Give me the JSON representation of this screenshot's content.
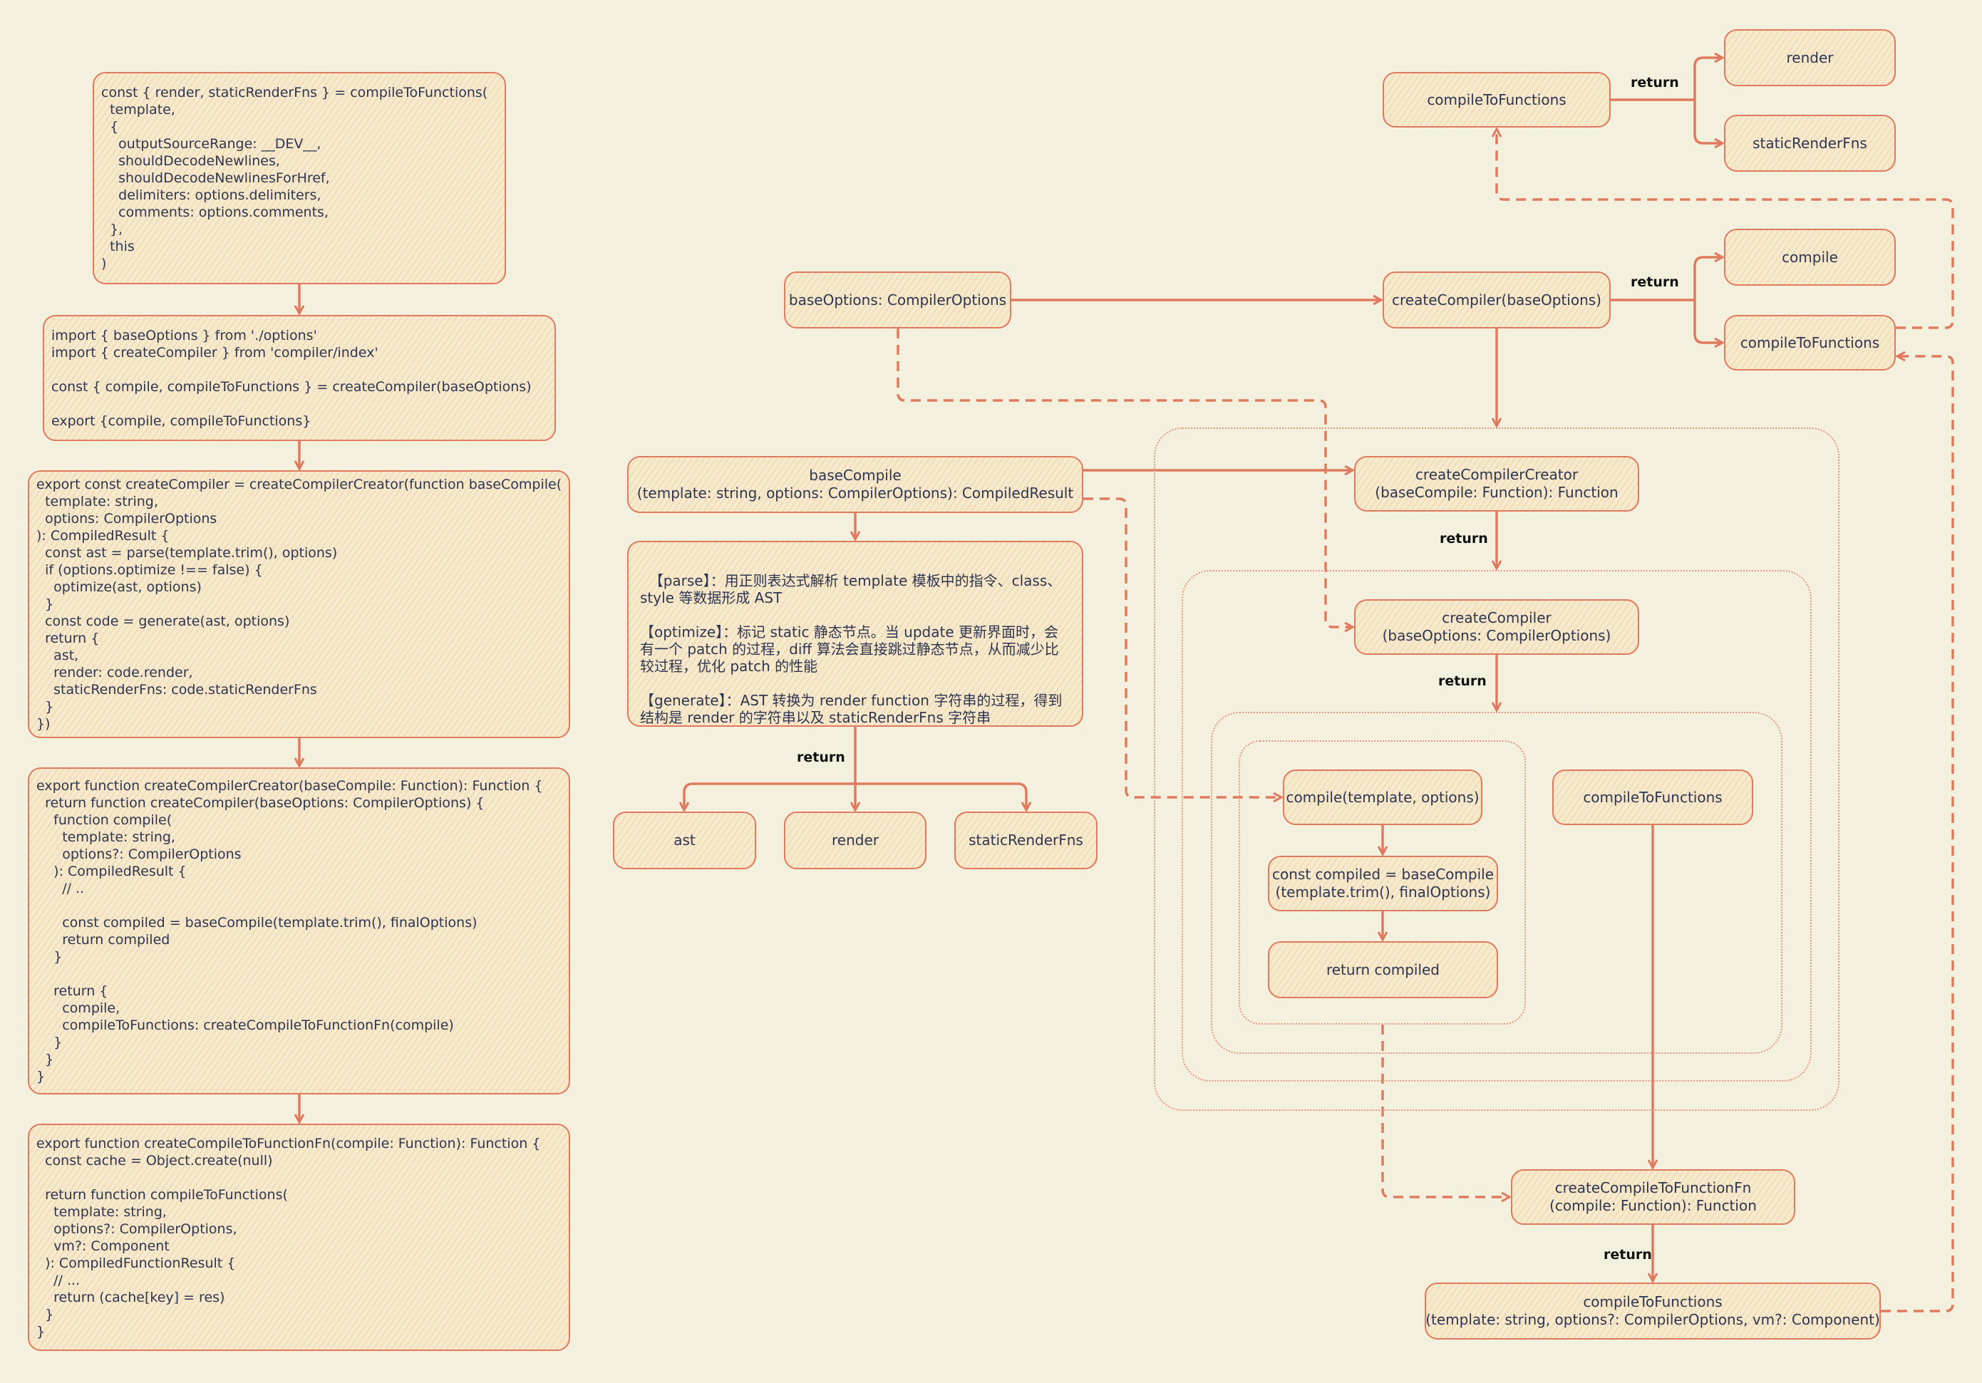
{
  "code_blocks": [
    {
      "lines": "const { render, staticRenderFns } = compileToFunctions(\n  template,\n  {\n    outputSourceRange: __DEV__,\n    shouldDecodeNewlines,\n    shouldDecodeNewlinesForHref,\n    delimiters: options.delimiters,\n    comments: options.comments,\n  },\n  this\n)"
    },
    {
      "lines": "import { baseOptions } from './options'\nimport { createCompiler } from 'compiler/index'\n\nconst { compile, compileToFunctions } = createCompiler(baseOptions)\n\nexport {compile, compileToFunctions}"
    },
    {
      "lines": "export const createCompiler = createCompilerCreator(function baseCompile(\n  template: string,\n  options: CompilerOptions\n): CompiledResult {\n  const ast = parse(template.trim(), options)\n  if (options.optimize !== false) {\n    optimize(ast, options)\n  }\n  const code = generate(ast, options)\n  return {\n    ast,\n    render: code.render,\n    staticRenderFns: code.staticRenderFns\n  }\n})"
    },
    {
      "lines": "export function createCompilerCreator(baseCompile: Function): Function {\n  return function createCompiler(baseOptions: CompilerOptions) {\n    function compile(\n      template: string,\n      options?: CompilerOptions\n    ): CompiledResult {\n      // ..\n\n      const compiled = baseCompile(template.trim(), finalOptions)\n      return compiled\n    }\n\n    return {\n      compile,\n      compileToFunctions: createCompileToFunctionFn(compile)\n    }\n  }\n}"
    },
    {
      "lines": "export function createCompileToFunctionFn(compile: Function): Function {\n  const cache = Object.create(null)\n\n  return function compileToFunctions(\n    template: string,\n    options?: CompilerOptions,\n    vm?: Component\n  ): CompiledFunctionResult {\n    // ...\n    return (cache[key] = res)\n  }\n}"
    }
  ],
  "middle": {
    "base_compile": "baseCompile\n(template: string, options: CompilerOptions): CompiledResult",
    "description": "【parse】：用正则表达式解析 template 模板中的指令、class、style 等数据形成 AST\n\n【optimize】：标记 static 静态节点。当 update 更新界面时，会有一个 patch 的过程，diff 算法会直接跳过静态节点，从而减少比较过程，优化 patch 的性能\n\n【generate】：AST 转换为 render function 字符串的过程，得到结构是 render 的字符串以及 staticRenderFns 字符串",
    "return_label": "return",
    "outputs": [
      "ast",
      "render",
      "staticRenderFns"
    ],
    "base_options": "baseOptions: CompilerOptions"
  },
  "right": {
    "compile_to_functions_top": "compileToFunctions",
    "top_outputs": [
      "render",
      "staticRenderFns"
    ],
    "create_compiler_call": "createCompiler(baseOptions)",
    "compiler_outputs": [
      "compile",
      "compileToFunctions"
    ],
    "create_compiler_creator": "createCompilerCreator\n(baseCompile: Function): Function",
    "create_compiler": "createCompiler\n(baseOptions: CompilerOptions)",
    "compile_fn": "compile(template, options)",
    "const_compiled": "const compiled = baseCompile\n(template.trim(), finalOptions)",
    "return_compiled": "return compiled",
    "compile_to_functions_inner": "compileToFunctions",
    "create_compile_to_function_fn": "createCompileToFunctionFn\n(compile: Function): Function",
    "compile_to_functions_sig": "compileToFunctions\n(template: string, options?: CompilerOptions, vm?: Component)",
    "return_label": "return"
  },
  "colors": {
    "background": "#f4f0de",
    "stroke": "#e07a5f",
    "fill": "#f5ead0",
    "text": "#2f3550"
  }
}
